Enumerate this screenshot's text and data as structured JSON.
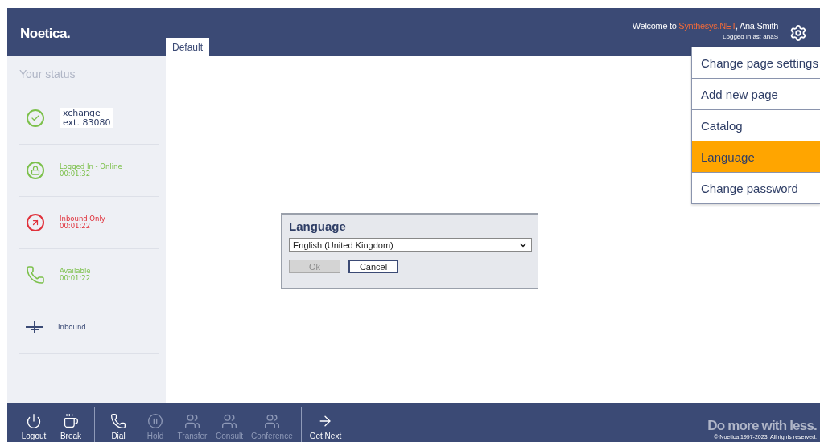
{
  "header": {
    "logo": "Noetica.",
    "tabs": [
      {
        "label": "Default",
        "selected": true
      }
    ],
    "welcome": [
      "Welcome to ",
      "Synthesys.NET",
      ", Ana Smith"
    ],
    "logged_in": "Logged in as: anaS"
  },
  "settings_menu": [
    {
      "label": "Change page settings",
      "selected": false
    },
    {
      "label": "Add new page",
      "selected": false
    },
    {
      "label": "Catalog",
      "selected": false
    },
    {
      "label": "Language",
      "selected": true
    },
    {
      "label": "Change password",
      "selected": false
    }
  ],
  "sidebar": {
    "title": "Your status",
    "items": [
      {
        "kind": "check",
        "color": "#7cc04b",
        "lines": [
          "xchange",
          "ext. 83080"
        ]
      },
      {
        "kind": "lock",
        "color": "#7cc04b",
        "lines": [
          "Logged In - Online",
          "00:01:32"
        ]
      },
      {
        "kind": "arrow",
        "color": "#e0303a",
        "lines": [
          "Inbound Only",
          "00:01:22"
        ]
      },
      {
        "kind": "phone",
        "color": "#7cc04b",
        "lines": [
          "Available",
          "00:01:22"
        ]
      },
      {
        "kind": "inbound",
        "color": "#3a4a75",
        "lines": [
          "Inbound"
        ]
      }
    ]
  },
  "dialog": {
    "title": "Language",
    "select_value": "English (United Kingdom)",
    "buttons": [
      {
        "label": "Ok",
        "disabled": true
      },
      {
        "label": "Cancel",
        "disabled": false
      }
    ]
  },
  "toolbar": [
    [
      {
        "kind": "power",
        "label": "Logout",
        "disabled": false
      },
      {
        "kind": "cup",
        "label": "Break",
        "disabled": false
      }
    ],
    [
      {
        "kind": "phone",
        "label": "Dial",
        "disabled": false
      },
      {
        "kind": "pause",
        "label": "Hold",
        "disabled": true
      },
      {
        "kind": "transfer",
        "label": "Transfer",
        "disabled": true
      },
      {
        "kind": "consult",
        "label": "Consult",
        "disabled": true
      },
      {
        "kind": "conference",
        "label": "Conference",
        "disabled": true
      }
    ],
    [
      {
        "kind": "next",
        "label": "Get Next",
        "disabled": false
      }
    ]
  ],
  "footer": {
    "slogan": "Do more with less.",
    "copyright": "© Noetica 1997-2023. All rights reserved."
  }
}
